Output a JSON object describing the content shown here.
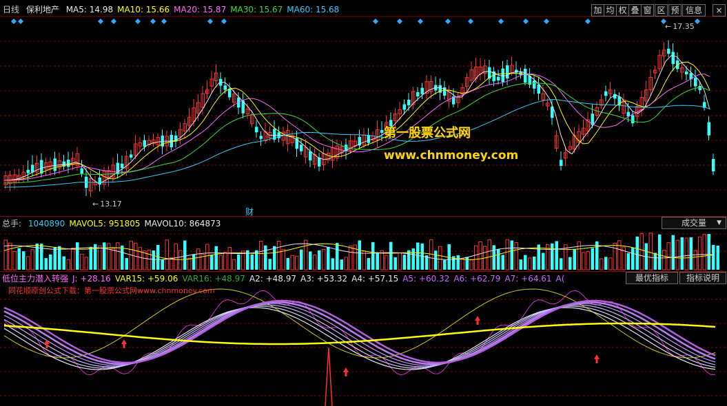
{
  "header": {
    "period": "日线",
    "stock_name": "保利地产",
    "ma": [
      {
        "label": "MA5: 14.98",
        "color": "#e8e8e8"
      },
      {
        "label": "MA10: 15.66",
        "color": "#ffff00"
      },
      {
        "label": "MA20: 15.87",
        "color": "#ff66ff"
      },
      {
        "label": "MA30: 15.67",
        "color": "#33dd33"
      },
      {
        "label": "MA60: 15.68",
        "color": "#33ccff"
      }
    ]
  },
  "toolbar": {
    "buttons": [
      "加",
      "均",
      "权",
      "叠",
      "窗",
      "区",
      "预",
      "信息"
    ]
  },
  "price_panel": {
    "high_label": "17.35",
    "low_label": "13.17",
    "marker": "财"
  },
  "watermark": {
    "line1": "第一股票公式网",
    "line2": "www.chnmoney.com"
  },
  "volume_panel": {
    "items": [
      {
        "label": "总手: ",
        "color": "#c8c8c8"
      },
      {
        "label": "1040890",
        "color": "#33ccff"
      },
      {
        "label": "MAVOL5: 951805",
        "color": "#ffff00"
      },
      {
        "label": "MAVOL10: 864873",
        "color": "#e8e8e8"
      }
    ],
    "dropdown_label": "成交量"
  },
  "indicator_panel": {
    "items": [
      {
        "label": "低位主力潜入转强",
        "color": "#ff66ff"
      },
      {
        "label": "J: +28.16",
        "color": "#ff66ff"
      },
      {
        "label": "VAR15: +59.06",
        "color": "#ffff00"
      },
      {
        "label": "VAR16: +48.97",
        "color": "#33aa33"
      },
      {
        "label": "A2: +48.97",
        "color": "#e8e8e8"
      },
      {
        "label": "A3: +53.32",
        "color": "#e8e8e8"
      },
      {
        "label": "A4: +57.15",
        "color": "#e8e8e8"
      },
      {
        "label": "A5: +60.32",
        "color": "#cc66ff"
      },
      {
        "label": "A6: +62.79",
        "color": "#cc66ff"
      },
      {
        "label": "A7: +64.61",
        "color": "#cc66ff"
      },
      {
        "label": "A(",
        "color": "#cc66ff"
      }
    ],
    "best_indicator_label": "最优指标",
    "indicator_help_label": "指标说明",
    "notice": "同花顺原创公式下载：第一股票公式网www.chnmoney.com"
  },
  "colors": {
    "up": "#ff3030",
    "down": "#33ffff",
    "grid": "#8a0000"
  }
}
